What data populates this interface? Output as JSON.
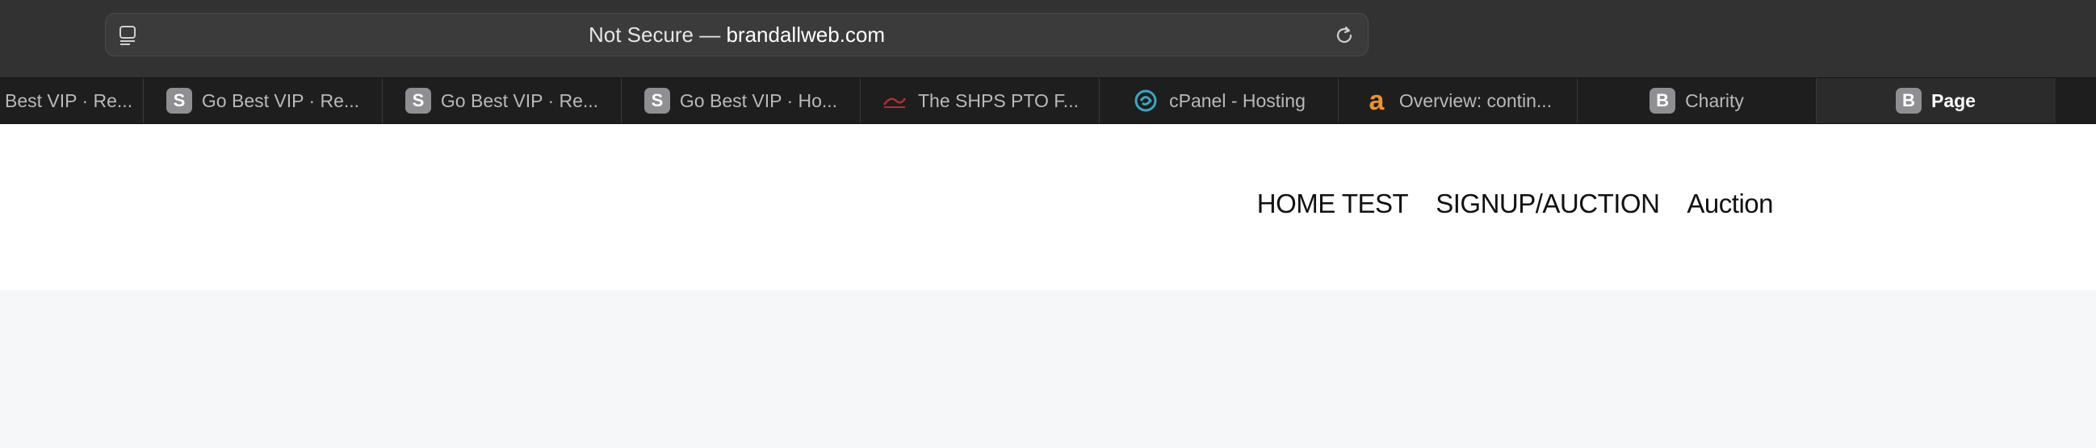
{
  "toolbar": {
    "url_prefix": "Not Secure — ",
    "url_domain": "brandallweb.com",
    "reader_icon": "reader-icon",
    "reload_icon": "reload-icon"
  },
  "tabs": [
    {
      "label": "Best VIP · Re...",
      "favicon": ""
    },
    {
      "label": "Go Best VIP · Re...",
      "favicon": "S"
    },
    {
      "label": "Go Best VIP · Re...",
      "favicon": "S"
    },
    {
      "label": "Go Best VIP · Ho...",
      "favicon": "S"
    },
    {
      "label": "The SHPS PTO F...",
      "favicon": "shps-logo-icon"
    },
    {
      "label": "cPanel - Hosting",
      "favicon": "cpanel-icon"
    },
    {
      "label": "Overview: contin...",
      "favicon": "a"
    },
    {
      "label": "Charity",
      "favicon": "B"
    },
    {
      "label": "Page",
      "favicon": "B",
      "active": true
    }
  ],
  "nav": {
    "items": [
      "HOME TEST",
      "SIGNUP/AUCTION",
      "Auction"
    ]
  },
  "colors": {
    "toolbar_bg": "#323232",
    "tabstrip_bg": "#1e1e1e",
    "active_tab_bg": "#2b2b2b",
    "favicon_gray": "#8e8e93",
    "amazon_orange": "#f0922b",
    "cpanel_teal": "#3aa6c2",
    "page_bg": "#f6f7f9"
  }
}
